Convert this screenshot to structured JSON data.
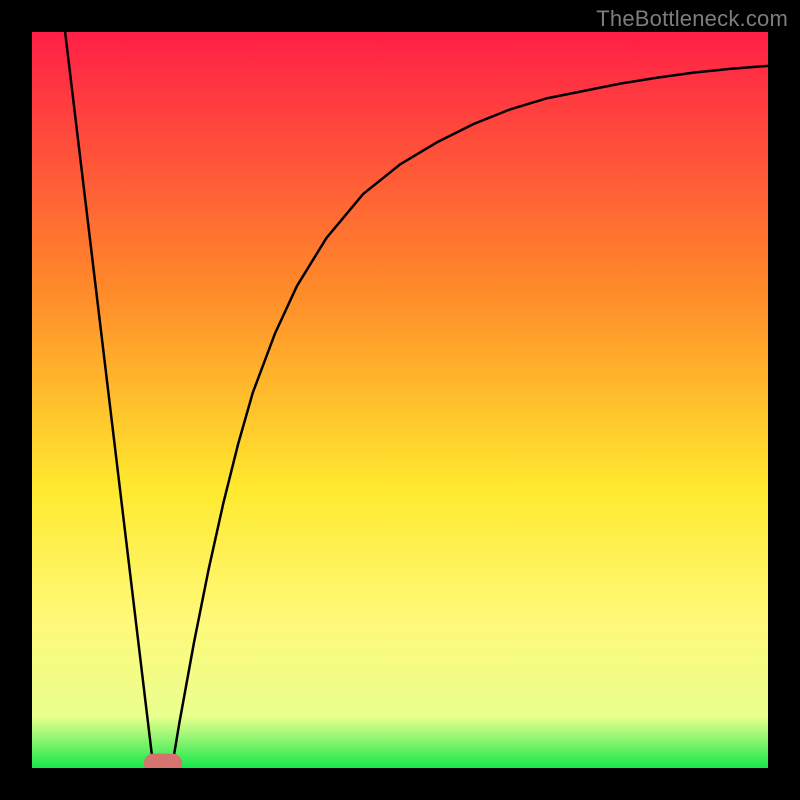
{
  "watermark": "TheBottleneck.com",
  "chart_data": {
    "type": "line",
    "title": "",
    "xlabel": "",
    "ylabel": "",
    "xlim": [
      0,
      100
    ],
    "ylim": [
      0,
      100
    ],
    "background_gradient": {
      "stops": [
        {
          "offset": 0,
          "color": "#ff1f47"
        },
        {
          "offset": 35,
          "color": "#ff8a2a"
        },
        {
          "offset": 62,
          "color": "#ffe92e"
        },
        {
          "offset": 80,
          "color": "#fff97a"
        },
        {
          "offset": 93,
          "color": "#eaff8e"
        },
        {
          "offset": 100,
          "color": "#17e84c"
        }
      ]
    },
    "series": [
      {
        "name": "left-branch",
        "color": "#000000",
        "width": 2.5,
        "points": [
          {
            "x": 4.5,
            "y": 100.0
          },
          {
            "x": 16.5,
            "y": 0.0
          }
        ]
      },
      {
        "name": "right-branch",
        "color": "#000000",
        "width": 2.5,
        "points": [
          {
            "x": 19.0,
            "y": 0.0
          },
          {
            "x": 20.0,
            "y": 6.0
          },
          {
            "x": 22.0,
            "y": 17.0
          },
          {
            "x": 24.0,
            "y": 27.0
          },
          {
            "x": 26.0,
            "y": 36.0
          },
          {
            "x": 28.0,
            "y": 44.0
          },
          {
            "x": 30.0,
            "y": 51.0
          },
          {
            "x": 33.0,
            "y": 59.0
          },
          {
            "x": 36.0,
            "y": 65.5
          },
          {
            "x": 40.0,
            "y": 72.0
          },
          {
            "x": 45.0,
            "y": 78.0
          },
          {
            "x": 50.0,
            "y": 82.0
          },
          {
            "x": 55.0,
            "y": 85.0
          },
          {
            "x": 60.0,
            "y": 87.5
          },
          {
            "x": 65.0,
            "y": 89.5
          },
          {
            "x": 70.0,
            "y": 91.0
          },
          {
            "x": 75.0,
            "y": 92.0
          },
          {
            "x": 80.0,
            "y": 93.0
          },
          {
            "x": 85.0,
            "y": 93.8
          },
          {
            "x": 90.0,
            "y": 94.5
          },
          {
            "x": 95.0,
            "y": 95.0
          },
          {
            "x": 100.0,
            "y": 95.4
          }
        ]
      }
    ],
    "marker": {
      "x": 17.8,
      "y": 0.0,
      "rx": 2.6,
      "ry": 1.3,
      "color": "#d6736e"
    }
  }
}
